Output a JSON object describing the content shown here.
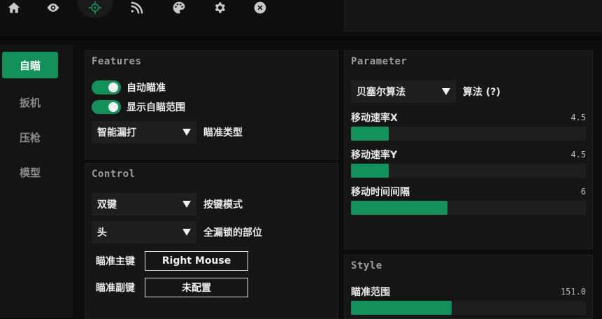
{
  "top_tabs": [
    {
      "name": "home-icon"
    },
    {
      "name": "eye-icon"
    },
    {
      "name": "crosshair-icon",
      "active": true
    },
    {
      "name": "signal-icon"
    },
    {
      "name": "palette-icon"
    },
    {
      "name": "gear-icon"
    },
    {
      "name": "close-icon"
    }
  ],
  "sidebar": {
    "items": [
      {
        "label": "自瞄",
        "active": true
      },
      {
        "label": "扳机"
      },
      {
        "label": "压枪"
      },
      {
        "label": "模型"
      }
    ]
  },
  "features": {
    "title": "Features",
    "toggle_aim": {
      "label": "自动瞄准",
      "on": true
    },
    "toggle_show_range": {
      "label": "显示自瞄范围",
      "on": true
    },
    "aim_type": {
      "value": "智能漏打",
      "label": "瞄准类型"
    }
  },
  "control": {
    "title": "Control",
    "key_mode": {
      "value": "双键",
      "label": "按键模式"
    },
    "body_part": {
      "value": "头",
      "label": "全漏锁的部位"
    },
    "primary_key": {
      "label": "瞄准主键",
      "value": "Right Mouse"
    },
    "secondary_key": {
      "label": "瞄准副键",
      "value": "未配置"
    }
  },
  "parameter": {
    "title": "Parameter",
    "algorithm": {
      "value": "贝塞尔算法",
      "label": "算法 (?)"
    },
    "sliders": [
      {
        "label": "移动速率X",
        "value": "4.5",
        "fill_fraction": 0.16
      },
      {
        "label": "移动速率Y",
        "value": "4.5",
        "fill_fraction": 0.16
      },
      {
        "label": "移动时间间隔",
        "value": "6",
        "fill_fraction": 0.41
      }
    ]
  },
  "style": {
    "title": "Style",
    "sliders": [
      {
        "label": "瞄准范围",
        "value": "151.0",
        "fill_fraction": 0.43
      }
    ]
  },
  "colors": {
    "accent": "#13915a",
    "background": "#0d0d0d",
    "panel": "#161616"
  }
}
